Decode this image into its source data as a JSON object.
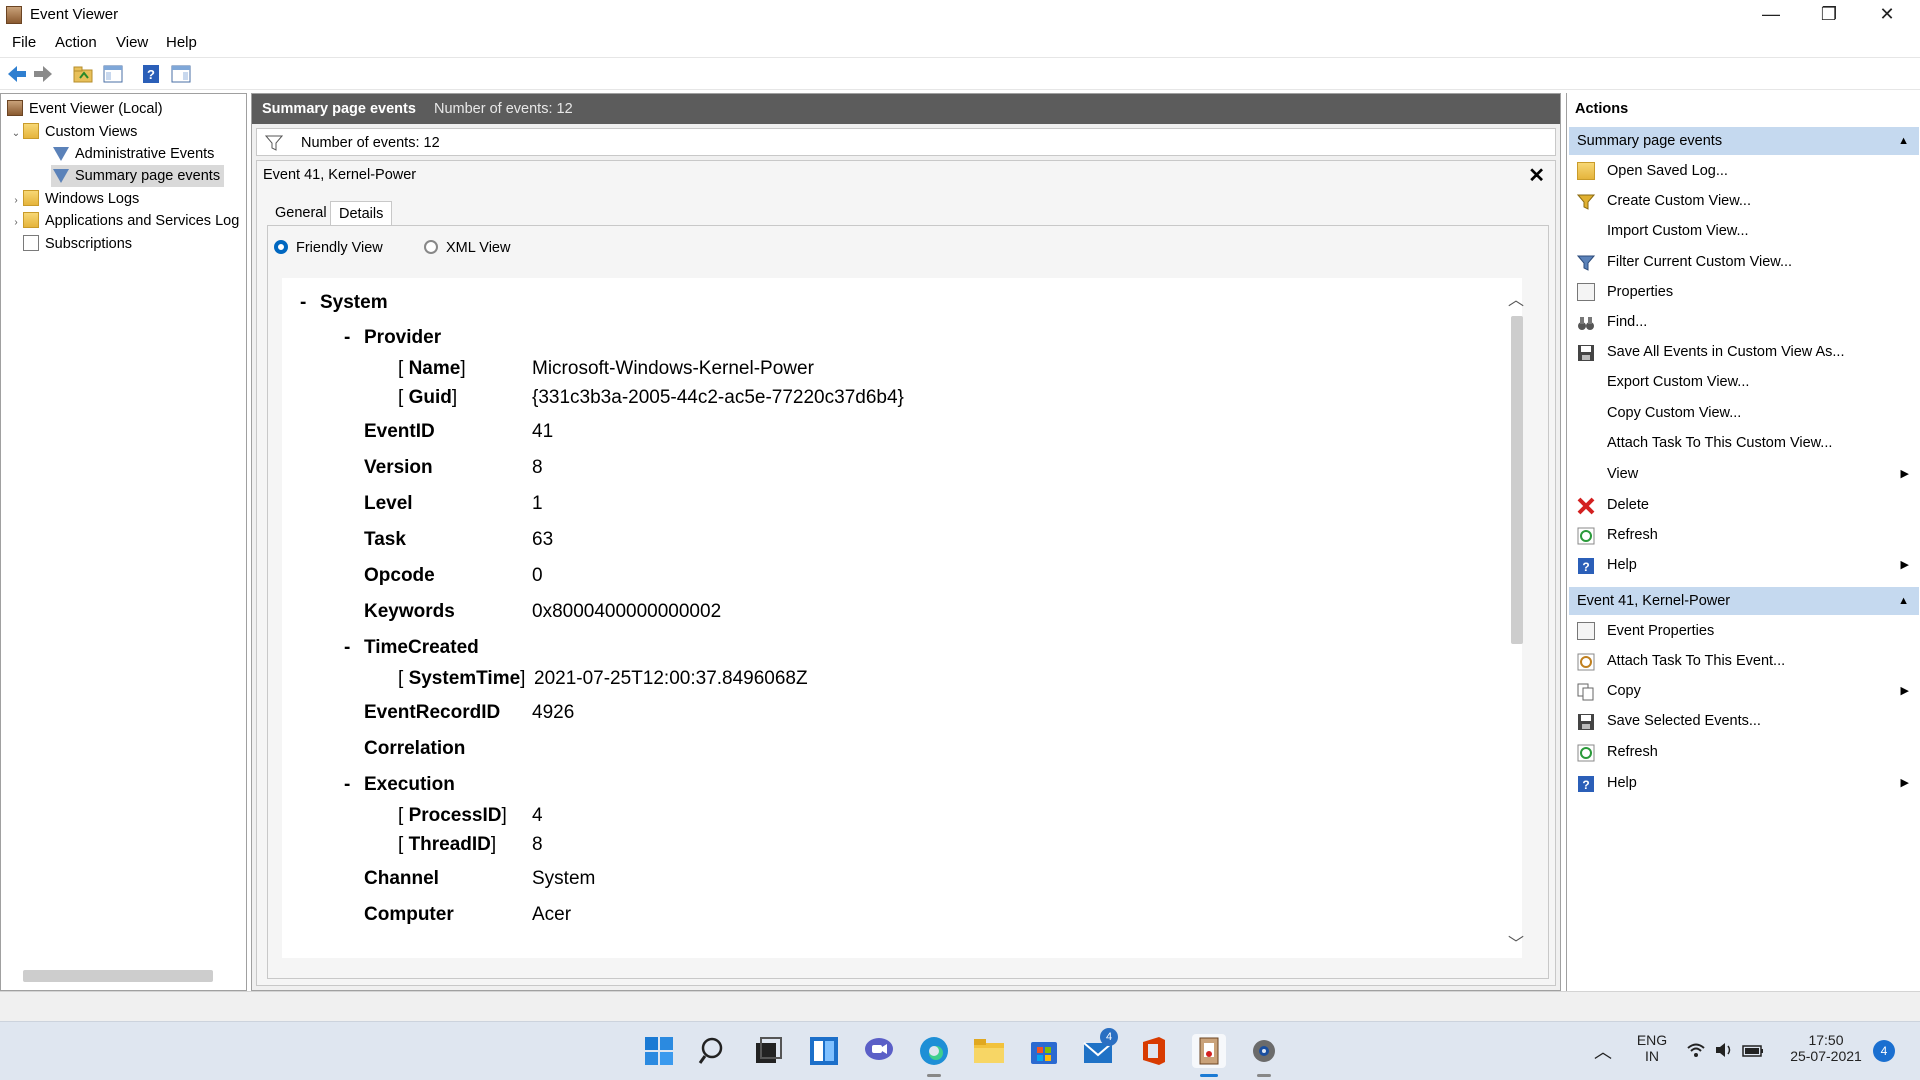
{
  "window": {
    "title": "Event Viewer",
    "minimize": "—",
    "restore": "❐",
    "close": "✕"
  },
  "menu": [
    "File",
    "Action",
    "View",
    "Help"
  ],
  "tree": {
    "root": "Event Viewer (Local)",
    "custom_views": "Custom Views",
    "admin_events": "Administrative Events",
    "summary_events": "Summary page events",
    "windows_logs": "Windows Logs",
    "apps_services": "Applications and Services Log",
    "subscriptions": "Subscriptions"
  },
  "center": {
    "header_title": "Summary page events",
    "header_count": "Number of events: 12",
    "filter_text": "Number of events: 12",
    "event_title": "Event 41, Kernel-Power",
    "close_glyph": "✕",
    "tabs": [
      "General",
      "Details"
    ],
    "views": [
      "Friendly View",
      "XML View"
    ]
  },
  "details": {
    "system": "System",
    "provider": "Provider",
    "name_key": "Name",
    "name_val": "Microsoft-Windows-Kernel-Power",
    "guid_key": "Guid",
    "guid_val": "{331c3b3a-2005-44c2-ac5e-77220c37d6b4}",
    "eventid_key": "EventID",
    "eventid_val": "41",
    "version_key": "Version",
    "version_val": "8",
    "level_key": "Level",
    "level_val": "1",
    "task_key": "Task",
    "task_val": "63",
    "opcode_key": "Opcode",
    "opcode_val": "0",
    "keywords_key": "Keywords",
    "keywords_val": "0x8000400000000002",
    "timecreated": "TimeCreated",
    "systemtime_key": "SystemTime",
    "systemtime_val": "2021-07-25T12:00:37.8496068Z",
    "recordid_key": "EventRecordID",
    "recordid_val": "4926",
    "correlation": "Correlation",
    "execution": "Execution",
    "processid_key": "ProcessID",
    "processid_val": "4",
    "threadid_key": "ThreadID",
    "threadid_val": "8",
    "channel_key": "Channel",
    "channel_val": "System",
    "computer_key": "Computer",
    "computer_val": "Acer"
  },
  "actions": {
    "title": "Actions",
    "section1": "Summary page events",
    "items1": [
      "Open Saved Log...",
      "Create Custom View...",
      "Import Custom View...",
      "Filter Current Custom View...",
      "Properties",
      "Find...",
      "Save All Events in Custom View As...",
      "Export Custom View...",
      "Copy Custom View...",
      "Attach Task To This Custom View...",
      "View",
      "Delete",
      "Refresh",
      "Help"
    ],
    "section2": "Event 41, Kernel-Power",
    "items2": [
      "Event Properties",
      "Attach Task To This Event...",
      "Copy",
      "Save Selected Events...",
      "Refresh",
      "Help"
    ]
  },
  "taskbar": {
    "lang1": "ENG",
    "lang2": "IN",
    "time": "17:50",
    "date": "25-07-2021",
    "mail_badge": "4",
    "notif_count": "4"
  }
}
